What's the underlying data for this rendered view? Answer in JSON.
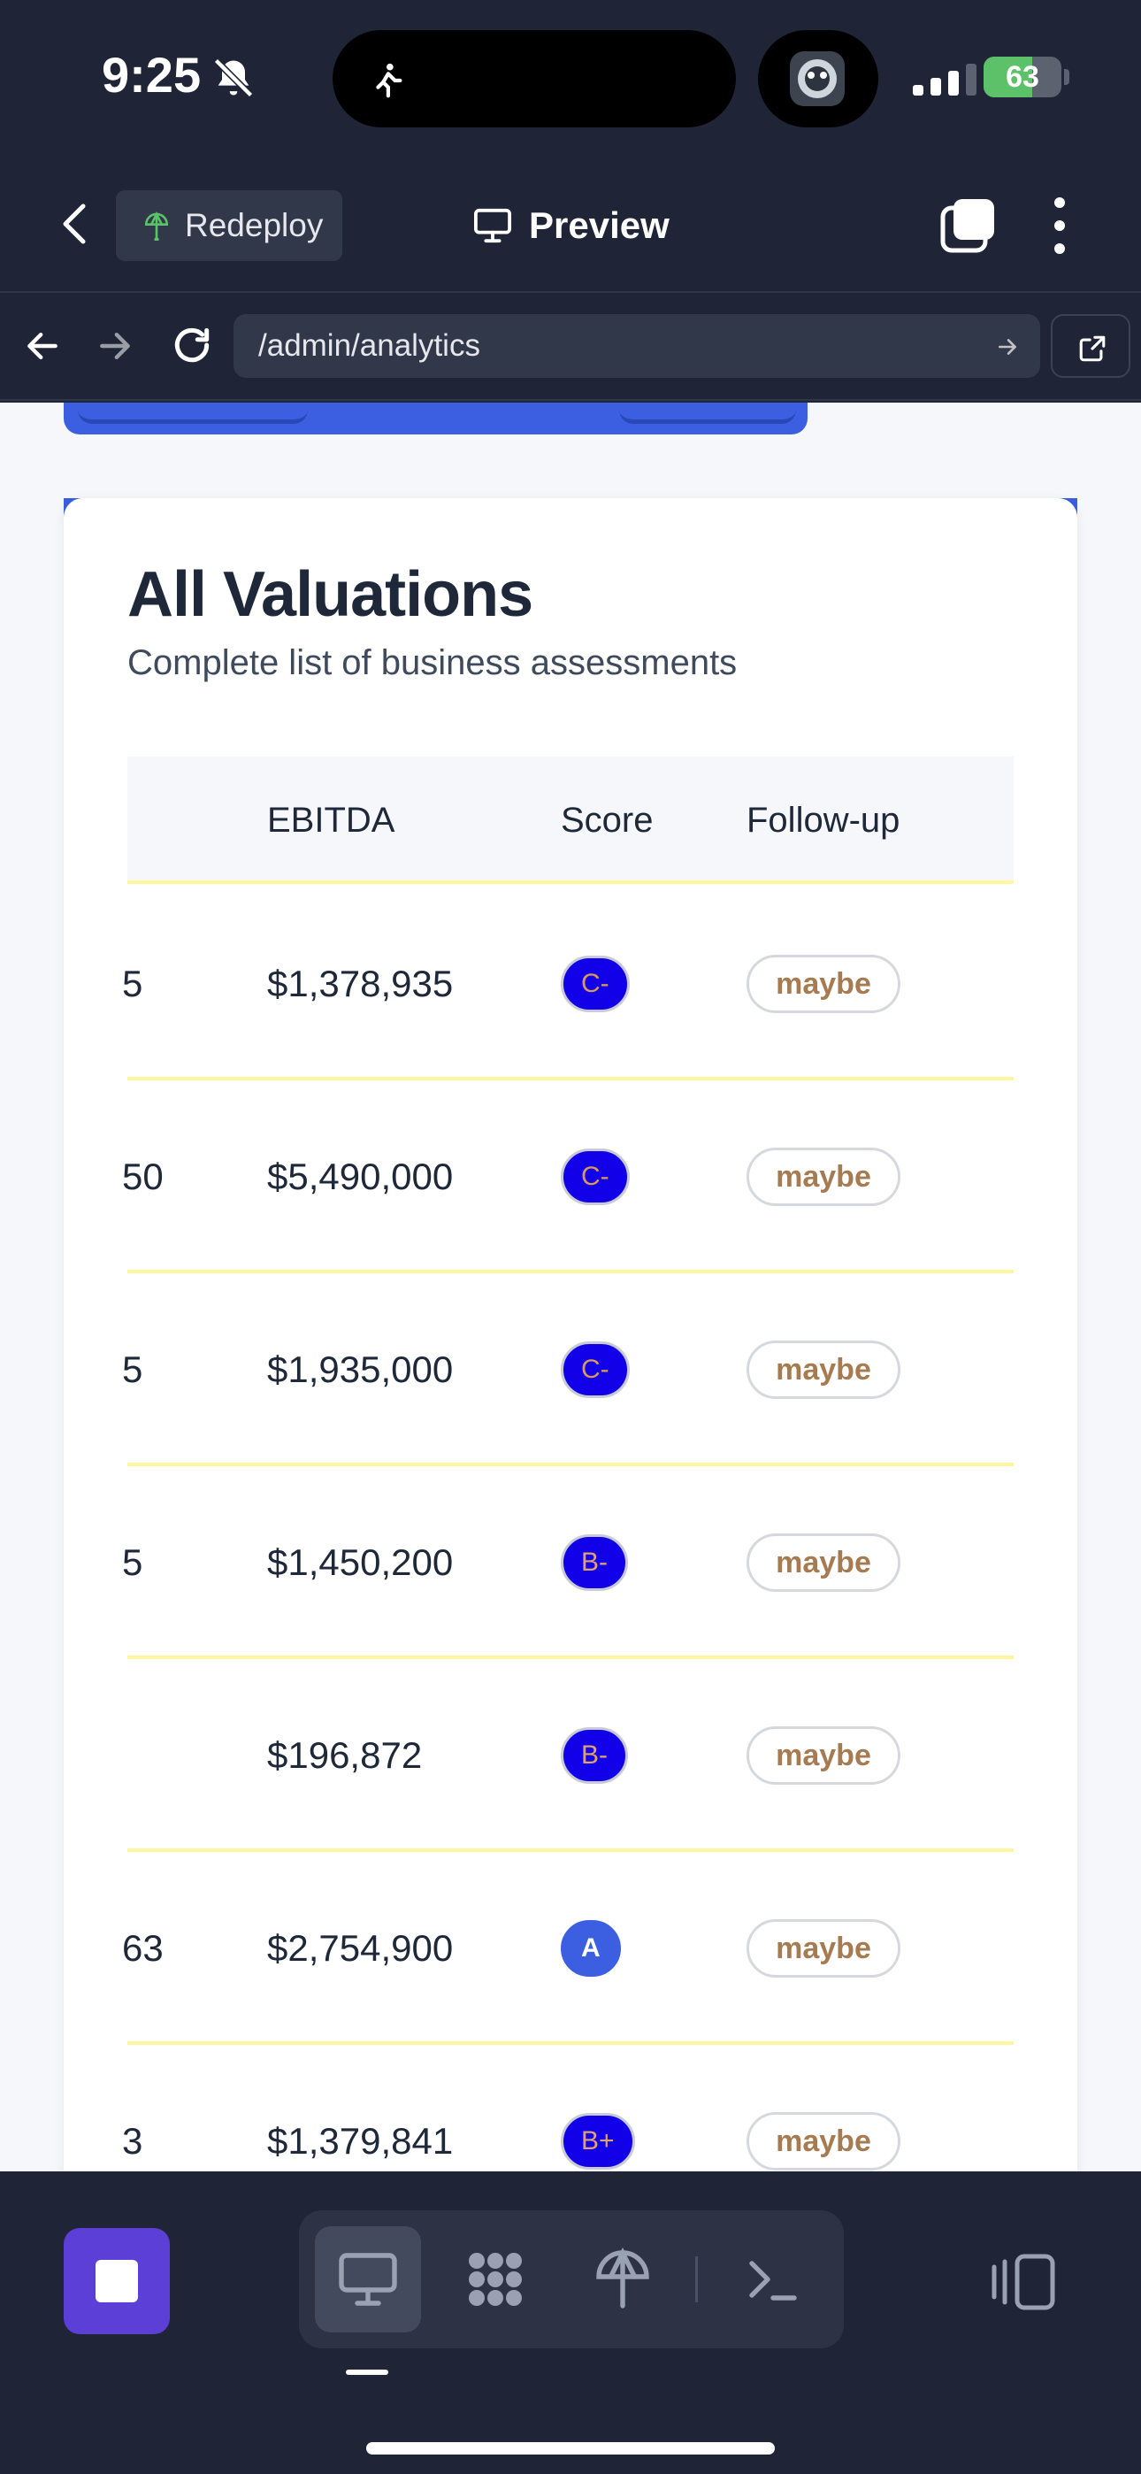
{
  "status_bar": {
    "time": "9:25",
    "battery": "63",
    "battery_level": 0.63
  },
  "header": {
    "redeploy_label": "Redeploy",
    "preview_label": "Preview"
  },
  "browser": {
    "url": "/admin/analytics"
  },
  "card": {
    "title": "All Valuations",
    "subtitle": "Complete list of business assessments"
  },
  "table": {
    "columns": {
      "ebitda": "EBITDA",
      "score": "Score",
      "followup": "Follow-up"
    },
    "rows": [
      {
        "cut": "5",
        "ebitda": "$1,378,935",
        "score": "C-",
        "followup": "maybe"
      },
      {
        "cut": "50",
        "ebitda": "$5,490,000",
        "score": "C-",
        "followup": "maybe"
      },
      {
        "cut": "5",
        "ebitda": "$1,935,000",
        "score": "C-",
        "followup": "maybe"
      },
      {
        "cut": "5",
        "ebitda": "$1,450,200",
        "score": "B-",
        "followup": "maybe"
      },
      {
        "cut": "",
        "ebitda": "$196,872",
        "score": "B-",
        "followup": "maybe"
      },
      {
        "cut": "63",
        "ebitda": "$2,754,900",
        "score": "A",
        "followup": "maybe"
      },
      {
        "cut": "3",
        "ebitda": "$1,379,841",
        "score": "B+",
        "followup": "maybe"
      }
    ]
  },
  "colors": {
    "background": "#1f2536",
    "accent": "#3b5fe0",
    "badge_blue": "#1200e8",
    "row_divider": "#fff59a",
    "followup_text": "#a67b52"
  },
  "icons": {
    "status": [
      "bell-slash-icon",
      "walking-icon",
      "signal-icon",
      "battery-icon"
    ],
    "header": [
      "chevron-left-icon",
      "redeploy-icon",
      "monitor-icon",
      "tabs-icon",
      "more-vertical-icon"
    ],
    "browser": [
      "arrow-left-icon",
      "arrow-right-icon",
      "reload-icon",
      "go-arrow-icon",
      "external-link-icon"
    ],
    "toolbar": [
      "stop-icon",
      "monitor-icon",
      "apps-grid-icon",
      "redeploy-icon",
      "terminal-icon",
      "panel-toggle-icon"
    ]
  }
}
